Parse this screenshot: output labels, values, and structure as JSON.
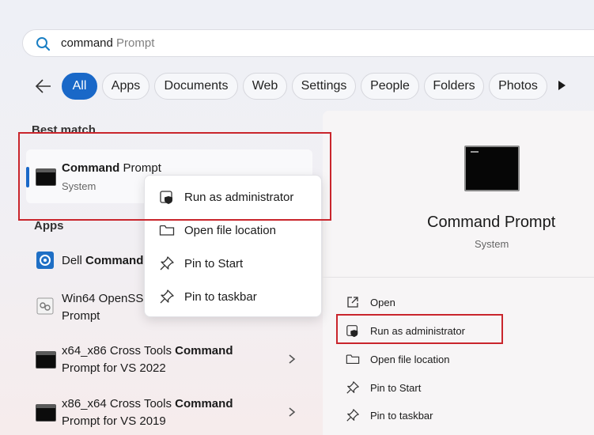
{
  "search": {
    "typed": "command",
    "suggestion": " Prompt"
  },
  "filters": [
    {
      "label": "All",
      "active": true
    },
    {
      "label": "Apps"
    },
    {
      "label": "Documents"
    },
    {
      "label": "Web"
    },
    {
      "label": "Settings"
    },
    {
      "label": "People"
    },
    {
      "label": "Folders"
    },
    {
      "label": "Photos"
    }
  ],
  "best_match": {
    "heading": "Best match",
    "title_bold": "Command",
    "title_rest": " Prompt",
    "subtitle": "System"
  },
  "apps": {
    "heading": "Apps",
    "items": [
      {
        "pre": "Dell ",
        "bold": "Command",
        "post": ""
      },
      {
        "line1": "Win64 OpenSS",
        "line2": "Prompt"
      },
      {
        "line1_pre": "x64_x86 Cross Tools ",
        "line1_bold": "Command",
        "line2": "Prompt for VS 2022"
      },
      {
        "line1_pre": "x86_x64 Cross Tools ",
        "line1_bold": "Command",
        "line2": "Prompt for VS 2019"
      }
    ]
  },
  "context_menu": [
    {
      "label": "Run as administrator",
      "icon": "shield-icon"
    },
    {
      "label": "Open file location",
      "icon": "folder-icon"
    },
    {
      "label": "Pin to Start",
      "icon": "pin-icon"
    },
    {
      "label": "Pin to taskbar",
      "icon": "pin-icon"
    }
  ],
  "details": {
    "title": "Command Prompt",
    "subtitle": "System",
    "actions": [
      {
        "label": "Open",
        "icon": "open-external-icon"
      },
      {
        "label": "Run as administrator",
        "icon": "shield-icon"
      },
      {
        "label": "Open file location",
        "icon": "folder-icon"
      },
      {
        "label": "Pin to Start",
        "icon": "pin-icon"
      },
      {
        "label": "Pin to taskbar",
        "icon": "pin-icon"
      }
    ]
  },
  "colors": {
    "accent": "#1968c8",
    "highlight": "#c9252c"
  }
}
